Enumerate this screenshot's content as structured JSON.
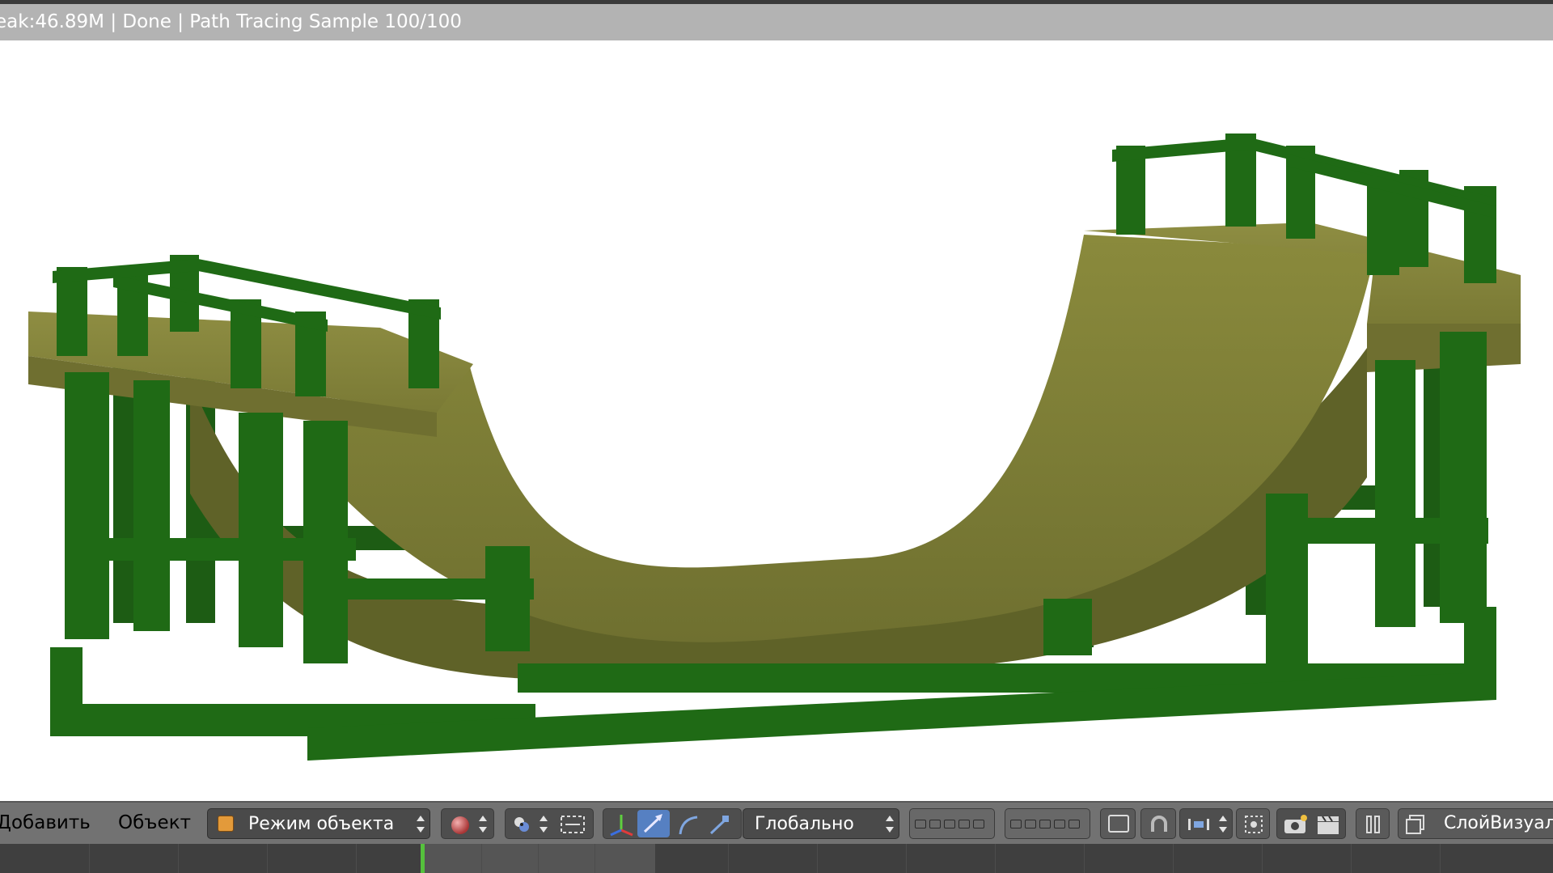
{
  "status_bar": {
    "text": "eak:46.89M | Done | Path Tracing Sample 100/100"
  },
  "viewport": {
    "scene": "rendered half-pipe skate ramp with green wooden frame",
    "ramp_color": "#7d7d35",
    "frame_color": "#1e6614"
  },
  "header": {
    "menu_add": "Добавить",
    "menu_object": "Объект",
    "mode_label": "Режим объекта",
    "orientation_label": "Глобально",
    "render_layer_label": "СлойВизуал",
    "icons": {
      "mode": "cube-icon",
      "shading": "sphere-shading-icon",
      "pivot": "pivot-point-icon",
      "manipulator_toggle": "manipulator-icon",
      "translate": "translate-arrow-icon",
      "rotate": "rotate-arc-icon",
      "scale": "scale-icon",
      "layers": "layer-grid-icon",
      "lock_camera": "lock-camera-icon",
      "snap": "magnet-icon",
      "snap_element": "snap-element-icon",
      "proportional": "proportional-edit-icon",
      "render_still": "render-camera-icon",
      "render_animation": "clapperboard-icon",
      "pause": "pause-icon",
      "render_layers": "render-layers-icon"
    }
  },
  "timeline": {
    "current_frame_marker": "frame-cursor"
  }
}
